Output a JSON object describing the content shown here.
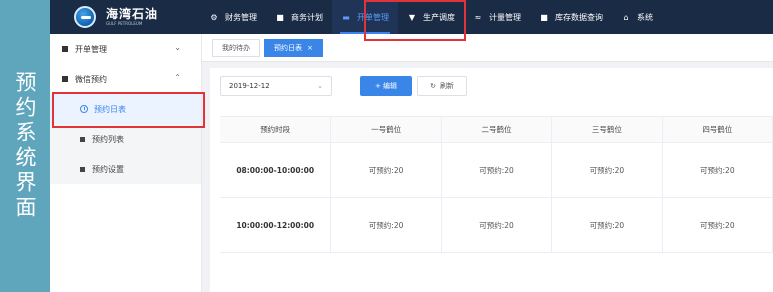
{
  "caption": {
    "text": "预约系统界面"
  },
  "brand": {
    "name_cn": "海湾石油",
    "name_en": "GULF PETROLEUM"
  },
  "nav": {
    "items": [
      {
        "label": "财务管理",
        "icon": "finance-icon"
      },
      {
        "label": "商务计划",
        "icon": "business-icon"
      },
      {
        "label": "开单管理",
        "icon": "order-icon",
        "active": true
      },
      {
        "label": "生产调度",
        "icon": "dispatch-icon"
      },
      {
        "label": "计量管理",
        "icon": "measure-icon"
      },
      {
        "label": "库存数据查询",
        "icon": "inventory-icon"
      },
      {
        "label": "系统",
        "icon": "home-icon"
      }
    ]
  },
  "sidebar": {
    "groups": [
      {
        "label": "开单管理",
        "expanded": false
      },
      {
        "label": "微信预约",
        "expanded": true
      }
    ],
    "sub_items": [
      {
        "label": "预约日表",
        "active": true
      },
      {
        "label": "预约列表"
      },
      {
        "label": "预约设置"
      }
    ]
  },
  "tabs": [
    {
      "label": "我的待办"
    },
    {
      "label": "预约日表",
      "close": "×",
      "active": true
    }
  ],
  "toolbar": {
    "date_value": "2019-12-12",
    "edit_label": "+ 编辑",
    "refresh_label": "刷新",
    "refresh_icon": "↻"
  },
  "table": {
    "headers": [
      "预约时段",
      "一号鹤位",
      "二号鹤位",
      "三号鹤位",
      "四号鹤位"
    ],
    "rows": [
      [
        "08:00:00-10:00:00",
        "可预约:20",
        "可预约:20",
        "可预约:20",
        "可预约:20"
      ],
      [
        "10:00:00-12:00:00",
        "可预约:20",
        "可预约:20",
        "可预约:20",
        "可预约:20"
      ]
    ]
  },
  "colors": {
    "topbar": "#1a2b45",
    "accent": "#3a86e8",
    "highlight": "#e0333a",
    "caption_bg": "#5fa6bd"
  }
}
